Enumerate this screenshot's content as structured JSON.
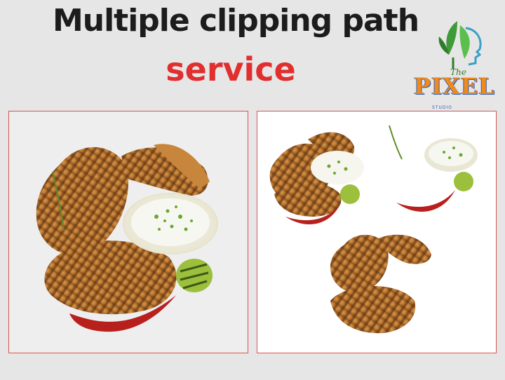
{
  "heading": {
    "title": "Multiple clipping path",
    "subtitle": "service"
  },
  "logo": {
    "the": "The",
    "word": "PIXEL",
    "tagline": "STUDIO"
  },
  "colors": {
    "title": "#1c1c1c",
    "subtitle": "#e12e2e",
    "panel_border": "#d9534f",
    "panel_before_bg": "#eeeeee",
    "panel_after_bg": "#ffffff",
    "page_bg": "#e6e6e6"
  },
  "icons": {
    "logo_mark": "leaf-face-icon"
  }
}
